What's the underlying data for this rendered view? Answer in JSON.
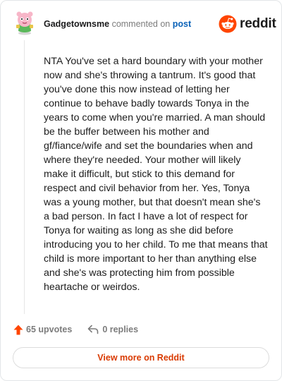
{
  "comment": {
    "username": "Gadgetownsme",
    "commented_on": "commented on",
    "post_link": "post",
    "body": "NTA You've set a hard boundary with your mother now and she's throwing a tantrum. It's good that you've done this now instead of letting her continue to behave badly towards Tonya in the years to come when you're married. A man should be the buffer between his mother and gf/fiance/wife and set the boundaries when and where they're needed. Your mother will likely make it difficult, but stick to this demand for respect and civil behavior from her. Yes, Tonya was a young mother, but that doesn't mean she's a bad person. In fact I have a lot of respect for Tonya for waiting as long as she did before introducing you to her child. To me that means that child is more important to her than anything else and she's was protecting him from possible heartache or weirdos."
  },
  "brand": {
    "wordmark": "reddit",
    "color": "#ff4500"
  },
  "actions": {
    "upvotes_label": "65 upvotes",
    "replies_label": "0 replies"
  },
  "footer": {
    "view_more_label": "View more on Reddit"
  },
  "icons": {
    "avatar": "snoo-avatar-icon",
    "logo": "reddit-snoo-icon",
    "upvote": "upvote-arrow-icon",
    "reply": "reply-arrow-icon"
  }
}
